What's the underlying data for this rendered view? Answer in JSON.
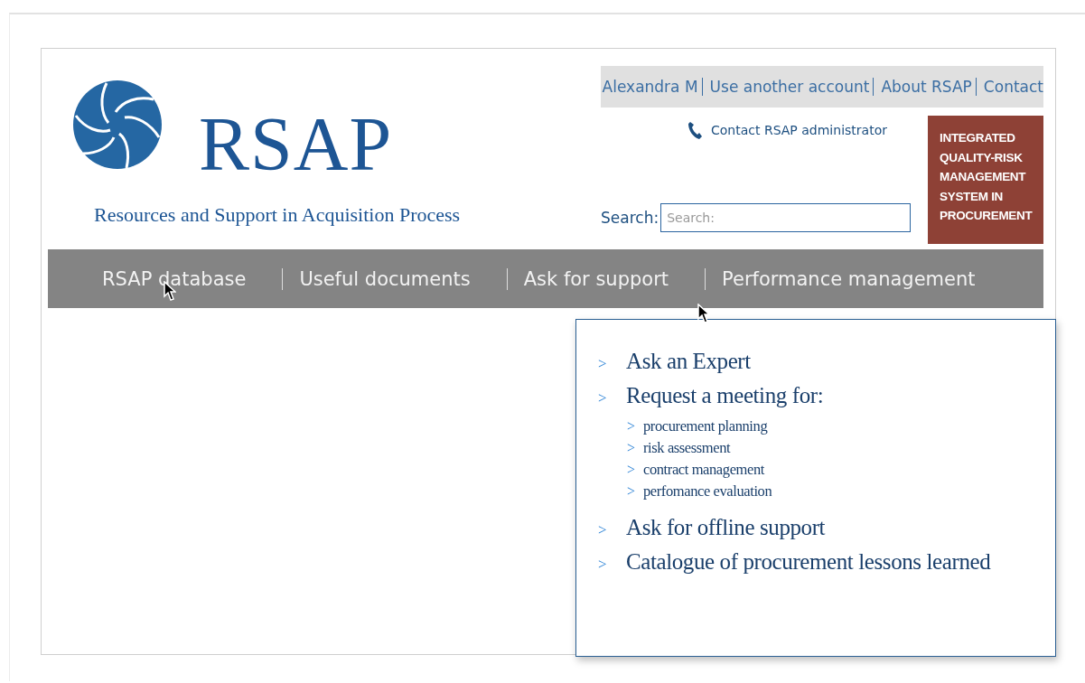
{
  "header": {
    "logo_text": "RSAP",
    "tagline": "Resources and Support in Acquisition Process"
  },
  "top_links": [
    {
      "label": "Alexandra M"
    },
    {
      "label": "Use another account"
    },
    {
      "label": "About RSAP"
    },
    {
      "label": "Contact"
    }
  ],
  "contact_admin": "Contact RSAP administrator",
  "search": {
    "label": "Search:",
    "placeholder": "Search:"
  },
  "banner": "INTEGRATED QUALITY-RISK MANAGEMENT SYSTEM IN PROCUREMENT",
  "nav": [
    {
      "label": "RSAP database"
    },
    {
      "label": "Useful documents"
    },
    {
      "label": "Ask for support"
    },
    {
      "label": "Performance management"
    }
  ],
  "dropdown": {
    "items": [
      {
        "bullet": ">",
        "label": "Ask an Expert"
      },
      {
        "bullet": ">",
        "label": "Request a meeting for:",
        "children": [
          {
            "bullet": ">",
            "label": "procurement planning"
          },
          {
            "bullet": ">",
            "label": "risk assessment"
          },
          {
            "bullet": ">",
            "label": "contract management"
          },
          {
            "bullet": ">",
            "label": "perfomance evaluation"
          }
        ]
      },
      {
        "bullet": ">",
        "label": "Ask for offline support"
      },
      {
        "bullet": ">",
        "label": "Catalogue of procurement lessons learned"
      }
    ]
  }
}
